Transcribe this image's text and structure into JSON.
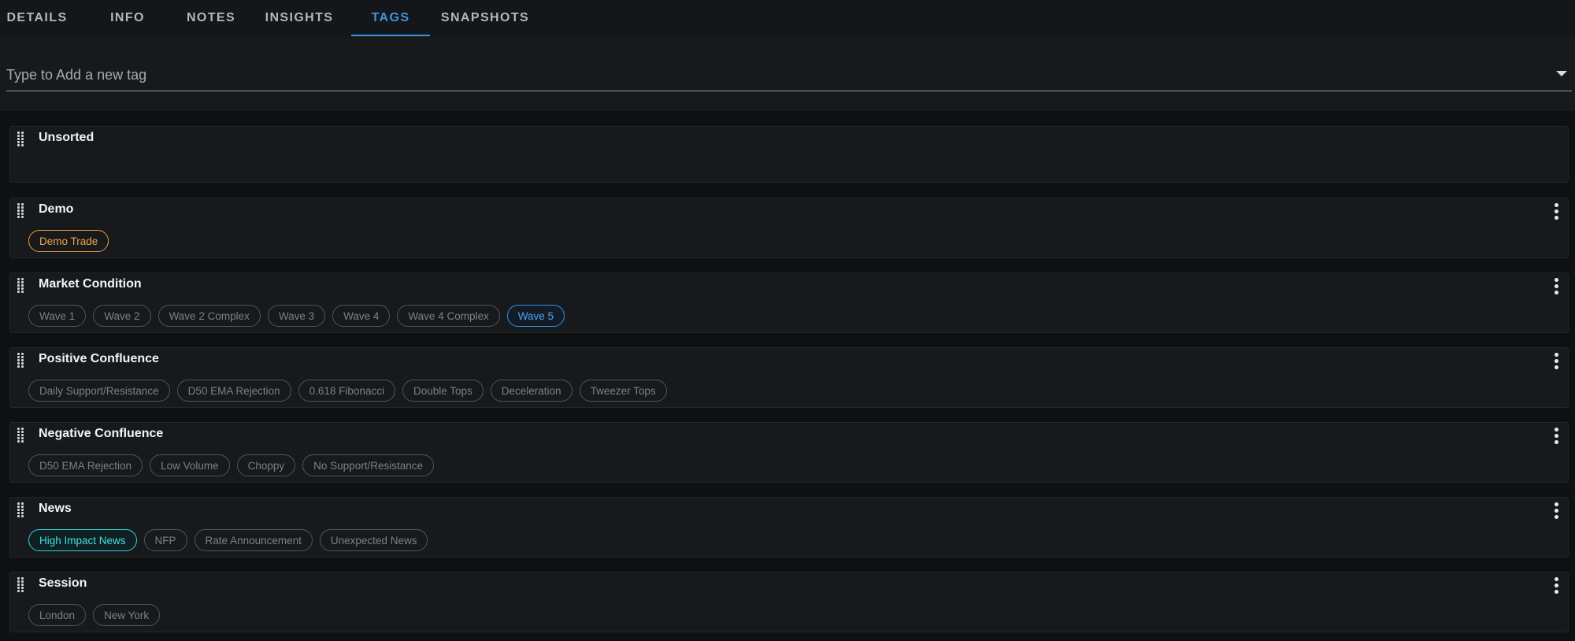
{
  "tabs": [
    {
      "label": "DETAILS"
    },
    {
      "label": "INFO"
    },
    {
      "label": "NOTES"
    },
    {
      "label": "INSIGHTS"
    },
    {
      "label": "TAGS",
      "active": true
    },
    {
      "label": "SNAPSHOTS"
    }
  ],
  "tag_input": {
    "placeholder": "Type to Add a new tag",
    "value": ""
  },
  "colors": {
    "accent_blue": "#3a95e3",
    "orange": "#e59a3a",
    "teal": "#35d0d4"
  },
  "groups": [
    {
      "title": "Unsorted",
      "has_menu": false,
      "tags": []
    },
    {
      "title": "Demo",
      "has_menu": true,
      "tags": [
        {
          "label": "Demo Trade",
          "style": "orange"
        }
      ]
    },
    {
      "title": "Market Condition",
      "has_menu": true,
      "tags": [
        {
          "label": "Wave 1"
        },
        {
          "label": "Wave 2"
        },
        {
          "label": "Wave 2 Complex"
        },
        {
          "label": "Wave 3"
        },
        {
          "label": "Wave 4"
        },
        {
          "label": "Wave 4 Complex"
        },
        {
          "label": "Wave 5",
          "style": "blue"
        }
      ]
    },
    {
      "title": "Positive Confluence",
      "has_menu": true,
      "tags": [
        {
          "label": "Daily Support/Resistance"
        },
        {
          "label": "D50 EMA Rejection"
        },
        {
          "label": "0.618 Fibonacci"
        },
        {
          "label": "Double Tops"
        },
        {
          "label": "Deceleration"
        },
        {
          "label": "Tweezer Tops"
        }
      ]
    },
    {
      "title": "Negative Confluence",
      "has_menu": true,
      "tags": [
        {
          "label": "D50 EMA Rejection"
        },
        {
          "label": "Low Volume"
        },
        {
          "label": "Choppy"
        },
        {
          "label": "No Support/Resistance"
        }
      ]
    },
    {
      "title": "News",
      "has_menu": true,
      "tags": [
        {
          "label": "High Impact News",
          "style": "teal"
        },
        {
          "label": "NFP"
        },
        {
          "label": "Rate Announcement"
        },
        {
          "label": "Unexpected News"
        }
      ]
    },
    {
      "title": "Session",
      "has_menu": true,
      "tags": [
        {
          "label": "London"
        },
        {
          "label": "New York"
        }
      ]
    }
  ]
}
